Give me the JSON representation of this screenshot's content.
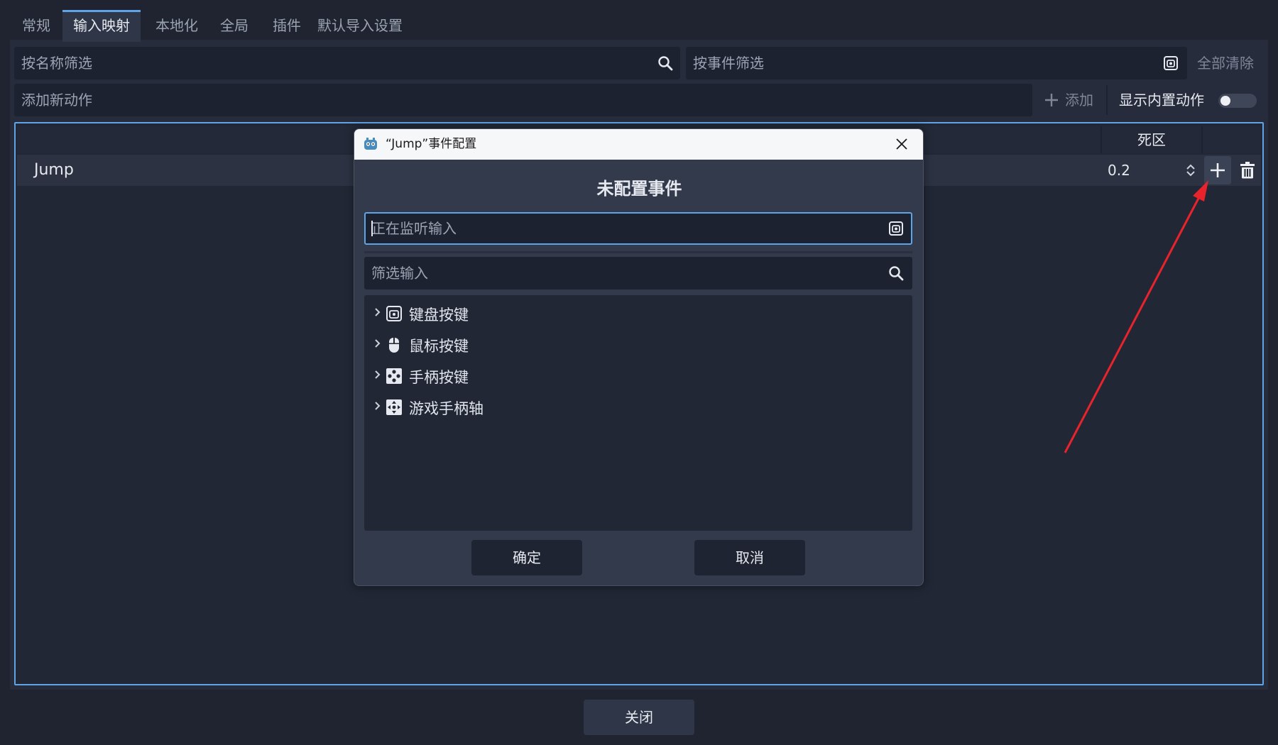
{
  "tabs": [
    {
      "label": "常规"
    },
    {
      "label": "输入映射",
      "active": true
    },
    {
      "label": "本地化"
    },
    {
      "label": "全局"
    },
    {
      "label": "插件"
    },
    {
      "label": "默认导入设置"
    }
  ],
  "filters": {
    "name_placeholder": "按名称筛选",
    "event_placeholder": "按事件筛选",
    "clear_all": "全部清除"
  },
  "add_action": {
    "placeholder": "添加新动作",
    "add_label": "添加",
    "show_builtin_label": "显示内置动作",
    "show_builtin_on": false
  },
  "table": {
    "deadzone_header": "死区",
    "rows": [
      {
        "action": "Jump",
        "deadzone": "0.2"
      }
    ]
  },
  "dialog": {
    "title": "“Jump”事件配置",
    "heading": "未配置事件",
    "listen_placeholder": "正在监听输入",
    "filter_placeholder": "筛选输入",
    "categories": [
      {
        "label": "键盘按键",
        "icon": "keyboard-icon"
      },
      {
        "label": "鼠标按键",
        "icon": "mouse-icon"
      },
      {
        "label": "手柄按键",
        "icon": "gamepad-button-icon"
      },
      {
        "label": "游戏手柄轴",
        "icon": "gamepad-axis-icon"
      }
    ],
    "ok_label": "确定",
    "cancel_label": "取消"
  },
  "footer": {
    "close_label": "关闭"
  },
  "colors": {
    "accent": "#5ea4e6",
    "annotation_arrow": "#e8232b"
  }
}
